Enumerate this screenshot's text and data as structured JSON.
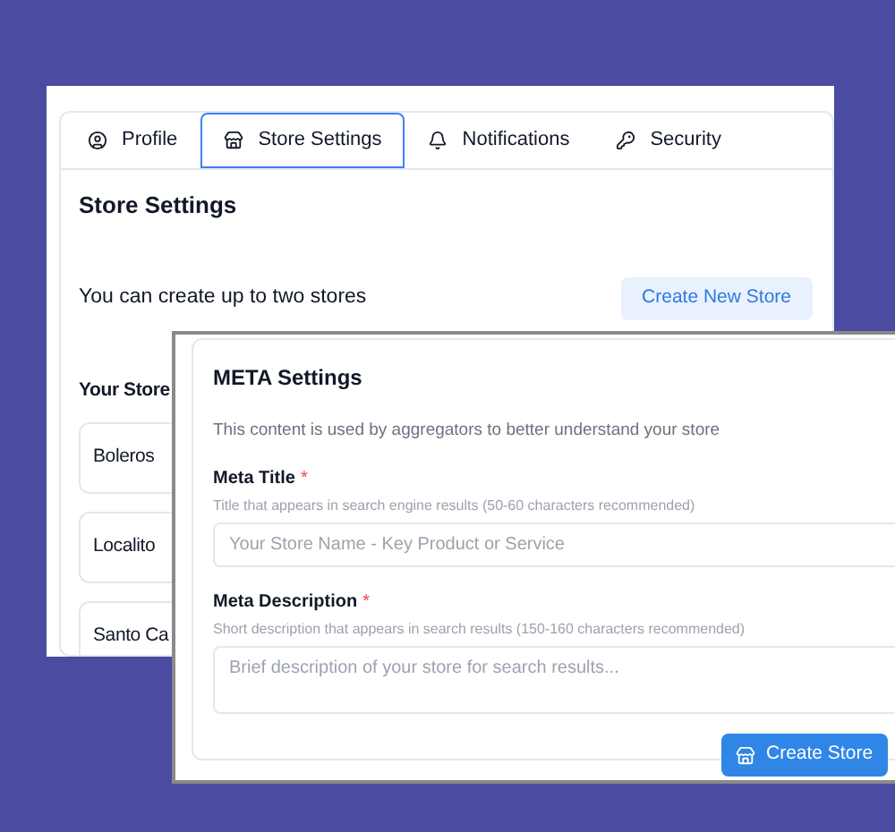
{
  "tabs": [
    {
      "label": "Profile",
      "selected": false
    },
    {
      "label": "Store Settings",
      "selected": true
    },
    {
      "label": "Notifications",
      "selected": false
    },
    {
      "label": "Security",
      "selected": false
    }
  ],
  "page_title": "Store Settings",
  "limit_text": "You can create up to two stores",
  "create_new_button": "Create New Store",
  "stores_heading": "Your Store",
  "stores": [
    {
      "name": "Boleros"
    },
    {
      "name": "Localito"
    },
    {
      "name": "Santo Ca"
    }
  ],
  "meta_dialog": {
    "title": "META Settings",
    "subtitle": "This content is used by aggregators to better understand your store",
    "fields": [
      {
        "kind": "input",
        "label": "Meta Title",
        "required_mark": "*",
        "hint": "Title that appears in search engine results (50-60 characters recommended)",
        "placeholder": "Your Store Name - Key Product or Service"
      },
      {
        "kind": "textarea",
        "label": "Meta Description",
        "required_mark": "*",
        "hint": "Short description that appears in search results (150-160 characters recommended)",
        "placeholder": "Brief description of your store for search results..."
      }
    ],
    "submit_button": "Create Store"
  }
}
